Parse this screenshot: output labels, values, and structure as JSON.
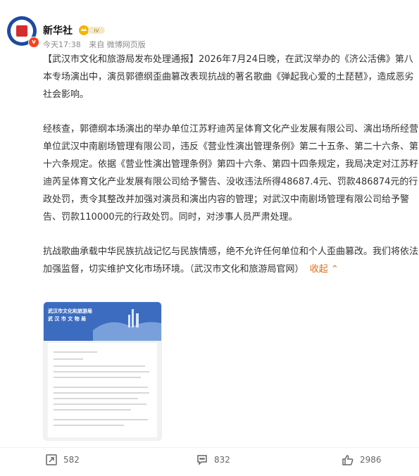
{
  "post": {
    "author": "新华社",
    "vip_badge": "IV",
    "time": "今天17:38",
    "source": "来自 微博网页版",
    "paragraph1": "【武汉市文化和旅游局发布处理通报】2026年7月24日晚，在武汉举办的《济公活佛》第八本专场演出中，演员郭德纲歪曲篡改表现抗战的著名歌曲《弹起我心爱的土琵琶》，造成恶劣社会影响。",
    "paragraph2": "经核查，郭德纲本场演出的举办单位江苏籽迪芮呈体育文化产业发展有限公司、演出场所经营单位武汉中南剧场管理有限公司，违反《营业性演出管理条例》第二十五条、第二十六条、第十六条规定。依据《营业性演出管理条例》第四十六条、第四十四条规定，我局决定对江苏籽迪芮呈体育文化产业发展有限公司给予警告、没收违法所得48687.4元、罚款486874元的行政处罚，责令其整改并加强对演员和演出内容的管理；对武汉中南剧场管理有限公司给予警告、罚款110000元的行政处罚。同时，对涉事人员严肃处理。",
    "paragraph3": "抗战歌曲承载中华民族抗战记忆与民族情感，绝不允许任何单位和个人歪曲篡改。我们将依法加强监督，切实维护文化市场环境。（武汉市文化和旅游局官网）",
    "collapse_label": "收起",
    "image": {
      "header_line1": "武汉市文化和旅游局",
      "header_line2": "武 汉 市 文 物 局"
    },
    "actions": {
      "repost": "582",
      "comment": "832",
      "like": "2986"
    }
  }
}
